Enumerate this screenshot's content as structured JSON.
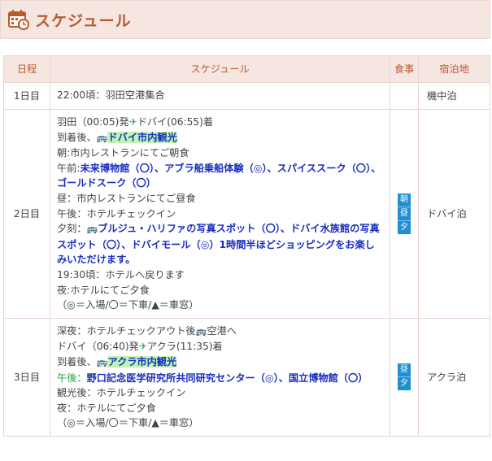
{
  "header": {
    "title": "スケジュール"
  },
  "table": {
    "headers": {
      "day": "日程",
      "schedule": "スケジュール",
      "meal": "食事",
      "stay": "宿泊地"
    },
    "rows": [
      {
        "day": "1日目",
        "line1": "22:00頃：羽田空港集合",
        "meals": [],
        "stay": "機中泊"
      },
      {
        "day": "2日目",
        "flight_a": "羽田（00:05)発",
        "flight_b": "ドバイ(06:55)着",
        "arrive_prefix": "到着後、",
        "arrive_tour": "ドバイ市内観光",
        "breakfast": "朝:市内レストランにてご朝食",
        "am_label": "午前:",
        "am_spots": "未来博物館（〇）、アブラ船乗船体験（◎）、スパイススーク（〇）、ゴールドスーク（〇）",
        "lunch": "昼：市内レストランにてご昼食",
        "pm": "午後：ホテルチェックイン",
        "eve_label": "夕刻：",
        "eve_spots": "ブルジュ・ハリファの写真スポット（〇）、ドバイ水族館の写真スポット（〇）、ドバイモール（◎）1時間半ほどショッピングをお楽しみいただけます。",
        "return": "19:30頃：ホテルへ戻ります",
        "dinner": "夜:ホテルにてご夕食",
        "legend": "（◎＝入場/〇＝下車/▲＝車窓）",
        "meals": [
          "朝",
          "昼",
          "夕"
        ],
        "stay": "ドバイ泊"
      },
      {
        "day": "3日目",
        "checkout_a": "深夜：ホテルチェックアウト後",
        "checkout_b": "空港へ",
        "flight_a": "ドバイ（06:40)発",
        "flight_b": "アクラ(11:35)着",
        "arrive_prefix": "到着後、",
        "arrive_tour": "アクラ市内観光",
        "pm_label": "午後：",
        "pm_spots": "野口記念医学研究所共同研究センター（◎）、国立博物館（〇）",
        "checkin": "観光後：ホテルチェックイン",
        "dinner": "夜：ホテルにてご夕食",
        "legend": "（◎＝入場/〇＝下車/▲＝車窓）",
        "meals": [
          "昼",
          "夕"
        ],
        "stay": "アクラ泊"
      }
    ]
  },
  "icons": {
    "bus": "bus-icon",
    "plane": "plane-icon",
    "calendar": "calendar-icon"
  },
  "colors": {
    "accent": "#b85a2c",
    "header_bg": "#f6e6e1",
    "link": "#1a2fbf",
    "meal_badge": "#1e8fd2"
  }
}
